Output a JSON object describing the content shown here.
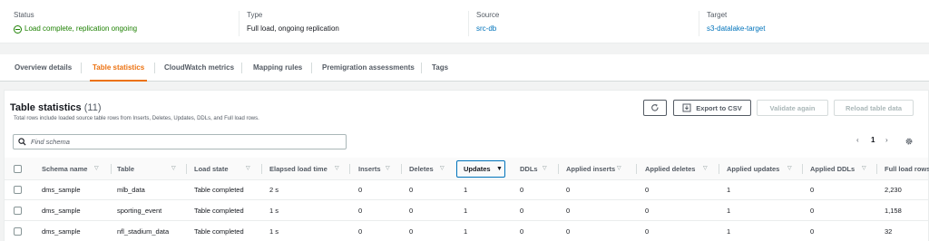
{
  "summary": {
    "status_label": "Status",
    "status_value": "Load complete, replication ongoing",
    "type_label": "Type",
    "type_value": "Full load, ongoing replication",
    "source_label": "Source",
    "source_value": "src-db",
    "target_label": "Target",
    "target_value": "s3-datalake-target",
    "colors": {
      "success": "#1d8102",
      "link": "#0073bb"
    }
  },
  "tabs": [
    {
      "label": "Overview details"
    },
    {
      "label": "Table statistics",
      "active": true
    },
    {
      "label": "CloudWatch metrics"
    },
    {
      "label": "Mapping rules"
    },
    {
      "label": "Premigration assessments"
    },
    {
      "label": "Tags"
    }
  ],
  "panel": {
    "title": "Table statistics",
    "count": "(11)",
    "subtitle": "Total rows include loaded source table rows from Inserts, Deletes, Updates, DDLs, and Full load rows.",
    "refresh_icon": "refresh-icon",
    "export_icon": "download-icon",
    "export_label": "Export to CSV",
    "validate_label": "Validate again",
    "reload_label": "Reload table data",
    "accent_color": "#ec7211"
  },
  "search": {
    "placeholder": "Find schema",
    "value": ""
  },
  "pagination": {
    "prev": "‹",
    "page": "1",
    "next": "›",
    "settings_icon": "gear-icon"
  },
  "table": {
    "columns": [
      "Schema name",
      "Table",
      "Load state",
      "Elapsed load time",
      "Inserts",
      "Deletes",
      "Updates",
      "DDLs",
      "Applied inserts",
      "Applied deletes",
      "Applied updates",
      "Applied DDLs",
      "Full load rows"
    ],
    "sorted_column": "Updates",
    "rows": [
      [
        "dms_sample",
        "mlb_data",
        "Table completed",
        "2 s",
        "0",
        "0",
        "1",
        "0",
        "0",
        "0",
        "1",
        "0",
        "2,230"
      ],
      [
        "dms_sample",
        "sporting_event",
        "Table completed",
        "1 s",
        "0",
        "0",
        "1",
        "0",
        "0",
        "0",
        "1",
        "0",
        "1,158"
      ],
      [
        "dms_sample",
        "nfl_stadium_data",
        "Table completed",
        "1 s",
        "0",
        "0",
        "1",
        "0",
        "0",
        "0",
        "1",
        "0",
        "32"
      ]
    ]
  }
}
